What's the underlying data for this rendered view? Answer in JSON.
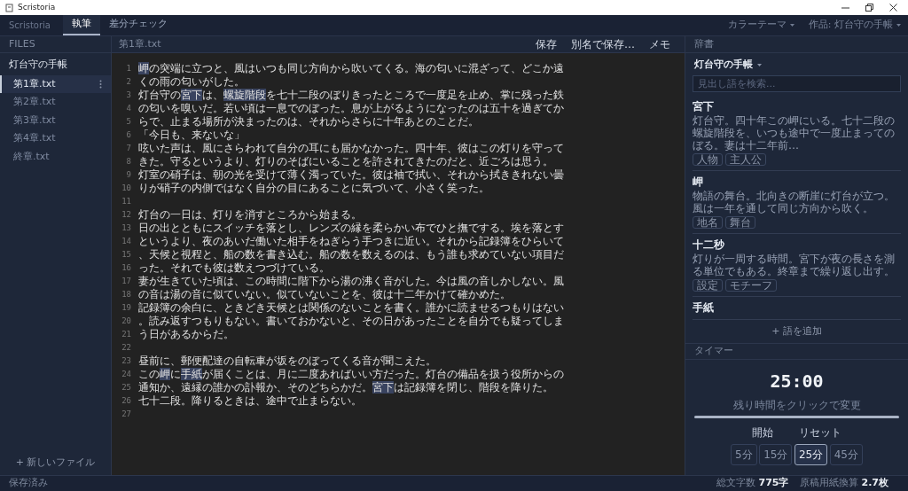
{
  "window": {
    "title": "Scristoria"
  },
  "topbar": {
    "brand": "Scristoria",
    "tabs": [
      {
        "label": "執筆",
        "selected": true
      },
      {
        "label": "差分チェック",
        "selected": false
      }
    ],
    "menus": [
      "カラーテーマ",
      "作品: 灯台守の手帳"
    ]
  },
  "sidebar": {
    "heading": "FILES",
    "project": "灯台守の手帳",
    "files": [
      {
        "name": "第1章.txt",
        "selected": true
      },
      {
        "name": "第2章.txt",
        "selected": false
      },
      {
        "name": "第3章.txt",
        "selected": false
      },
      {
        "name": "第4章.txt",
        "selected": false
      },
      {
        "name": "終章.txt",
        "selected": false
      }
    ],
    "new_file": "+ 新しいファイル"
  },
  "editor": {
    "filename": "第1章.txt",
    "actions": [
      "保存",
      "別名で保存…",
      "メモ"
    ],
    "lines": [
      {
        "number": "1",
        "segments": [
          {
            "text": "岬",
            "term": true
          },
          {
            "text": "の突端に立つと、風はいつも同じ方向から吹いてくる。海の匂いに混ざって、どこか遠",
            "term": false
          }
        ]
      },
      {
        "number": "2",
        "segments": [
          {
            "text": "くの雨の匂いがした。",
            "term": false
          }
        ]
      },
      {
        "number": "3",
        "segments": [
          {
            "text": "灯台守の",
            "term": false
          },
          {
            "text": "宮下",
            "term": true
          },
          {
            "text": "は、",
            "term": false
          },
          {
            "text": "螺旋階段",
            "term": true
          },
          {
            "text": "を七十二段のぼりきったところで一度足を止め、掌に残った鉄",
            "term": false
          }
        ]
      },
      {
        "number": "4",
        "segments": [
          {
            "text": "の匂いを嗅いだ。若い頃は一息でのぼった。息が上がるようになったのは五十を過ぎてか",
            "term": false
          }
        ]
      },
      {
        "number": "5",
        "segments": [
          {
            "text": "らで、止まる場所が決まったのは、それからさらに十年あとのことだ。",
            "term": false
          }
        ]
      },
      {
        "number": "6",
        "segments": [
          {
            "text": "「今日も、来ないな」",
            "term": false
          }
        ]
      },
      {
        "number": "7",
        "segments": [
          {
            "text": "呟いた声は、風にさらわれて自分の耳にも届かなかった。四十年、彼はこの灯りを守って",
            "term": false
          }
        ]
      },
      {
        "number": "8",
        "segments": [
          {
            "text": "きた。守るというより、灯りのそばにいることを許されてきたのだと、近ごろは思う。",
            "term": false
          }
        ]
      },
      {
        "number": "9",
        "segments": [
          {
            "text": "灯室の硝子は、朝の光を受けて薄く濁っていた。彼は袖で拭い、それから拭ききれない曇",
            "term": false
          }
        ]
      },
      {
        "number": "10",
        "segments": [
          {
            "text": "りが硝子の内側ではなく自分の目にあることに気づいて、小さく笑った。",
            "term": false
          }
        ]
      },
      {
        "number": "11"
      },
      {
        "number": "12",
        "segments": [
          {
            "text": "灯台の一日は、灯りを消すところから始まる。",
            "term": false
          }
        ]
      },
      {
        "number": "13",
        "segments": [
          {
            "text": "日の出とともにスイッチを落とし、レンズの縁を柔らかい布でひと撫でする。埃を落とす",
            "term": false
          }
        ]
      },
      {
        "number": "14",
        "segments": [
          {
            "text": "というより、夜のあいだ働いた相手をねぎらう手つきに近い。それから記録簿をひらいて",
            "term": false
          }
        ]
      },
      {
        "number": "15",
        "segments": [
          {
            "text": "、天候と視程と、船の数を書き込む。船の数を数えるのは、もう誰も求めていない項目だ",
            "term": false
          }
        ]
      },
      {
        "number": "16",
        "segments": [
          {
            "text": "った。それでも彼は数えつづけている。",
            "term": false
          }
        ]
      },
      {
        "number": "17",
        "segments": [
          {
            "text": "妻が生きていた頃は、この時間に階下から湯の沸く音がした。今は風の音しかしない。風",
            "term": false
          }
        ]
      },
      {
        "number": "18",
        "segments": [
          {
            "text": "の音は湯の音に似ていない。似ていないことを、彼は十二年かけて確かめた。",
            "term": false
          }
        ]
      },
      {
        "number": "19",
        "segments": [
          {
            "text": "記録簿の余白に、ときどき天候とは関係のないことを書く。誰かに読ませるつもりはない",
            "term": false
          }
        ]
      },
      {
        "number": "20",
        "segments": [
          {
            "text": "。読み返すつもりもない。書いておかないと、その日があったことを自分でも疑ってしま",
            "term": false
          }
        ]
      },
      {
        "number": "21",
        "segments": [
          {
            "text": "う日があるからだ。",
            "term": false
          }
        ]
      },
      {
        "number": "22"
      },
      {
        "number": "23",
        "segments": [
          {
            "text": "昼前に、郵便配達の自転車が坂をのぼってくる音が聞こえた。",
            "term": false
          }
        ]
      },
      {
        "number": "24",
        "segments": [
          {
            "text": "この",
            "term": false
          },
          {
            "text": "岬",
            "term": true
          },
          {
            "text": "に",
            "term": false
          },
          {
            "text": "手紙",
            "term": true
          },
          {
            "text": "が届くことは、月に二度あればいい方だった。灯台の備品を扱う役所からの",
            "term": false
          }
        ]
      },
      {
        "number": "25",
        "segments": [
          {
            "text": "通知か、遠縁の誰かの訃報か、そのどちらかだ。",
            "term": false
          },
          {
            "text": "宮下",
            "term": true
          },
          {
            "text": "は記録簿を閉じ、階段を降りた。",
            "term": false
          }
        ]
      },
      {
        "number": "26",
        "segments": [
          {
            "text": "七十二段。降りるときは、途中で止まらない。",
            "term": false
          }
        ]
      },
      {
        "number": "27"
      }
    ]
  },
  "dictionary": {
    "heading": "辞書",
    "collection": "灯台守の手帳",
    "search": {
      "placeholder": "見出し語を検索..."
    },
    "entries": [
      {
        "term": "宮下",
        "description": "灯台守。四十年この岬にいる。七十二段の螺旋階段を、いつも途中で一度止まってのぼる。妻は十二年前…",
        "tags": [
          "人物",
          "主人公"
        ]
      },
      {
        "term": "岬",
        "description": "物語の舞台。北向きの断崖に灯台が立つ。風は一年を通して同じ方向から吹く。",
        "tags": [
          "地名",
          "舞台"
        ]
      },
      {
        "term": "十二秒",
        "description": "灯りが一周する時間。宮下が夜の長さを測る単位でもある。終章まで繰り返し出す。",
        "tags": [
          "設定",
          "モチーフ"
        ]
      },
      {
        "term": "手紙"
      }
    ],
    "add": "+ 語を追加"
  },
  "timer": {
    "heading": "タイマー",
    "time": "25:00",
    "hint": "残り時間をクリックで変更",
    "level": 1.0,
    "buttons": [
      "開始",
      "リセット"
    ],
    "presets": [
      {
        "label": "5分",
        "selected": false
      },
      {
        "label": "15分",
        "selected": false
      },
      {
        "label": "25分",
        "selected": true
      },
      {
        "label": "45分",
        "selected": false
      }
    ]
  },
  "status_bar": {
    "left": "保存済み",
    "stats": [
      {
        "label": "総文字数",
        "value": "775字"
      },
      {
        "label": "原稿用紙換算",
        "value": "2.7枚"
      }
    ]
  }
}
